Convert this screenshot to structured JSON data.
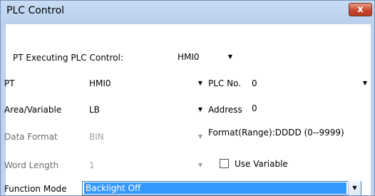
{
  "window": {
    "title": "PLC Control",
    "close_label": "x"
  },
  "form": {
    "pt_executing_label": "PT Executing PLC Control:",
    "pt_executing_value": "HMI0",
    "pt_label": "PT",
    "pt_value": "HMI0",
    "plc_no_label": "PLC No.",
    "plc_no_value": "0",
    "area_label": "Area/Variable",
    "area_value": "LB",
    "address_label": "Address",
    "address_value": "0",
    "data_format_label": "Data Format",
    "data_format_value": "BIN",
    "format_range_text": "Format(Range):DDDD (0--9999)",
    "word_length_label": "Word Length",
    "word_length_value": "1",
    "use_variable_label": "Use Variable",
    "use_variable_checked": false,
    "function_mode_label": "Function Mode",
    "function_mode_value": "Backlight Off"
  },
  "icons": {
    "dropdown_arrow": "▼"
  },
  "colors": {
    "frame": "#bcd2ee",
    "close_button": "#c6482d",
    "selection": "#3399ff",
    "disabled_text": "#a0a0a0"
  }
}
